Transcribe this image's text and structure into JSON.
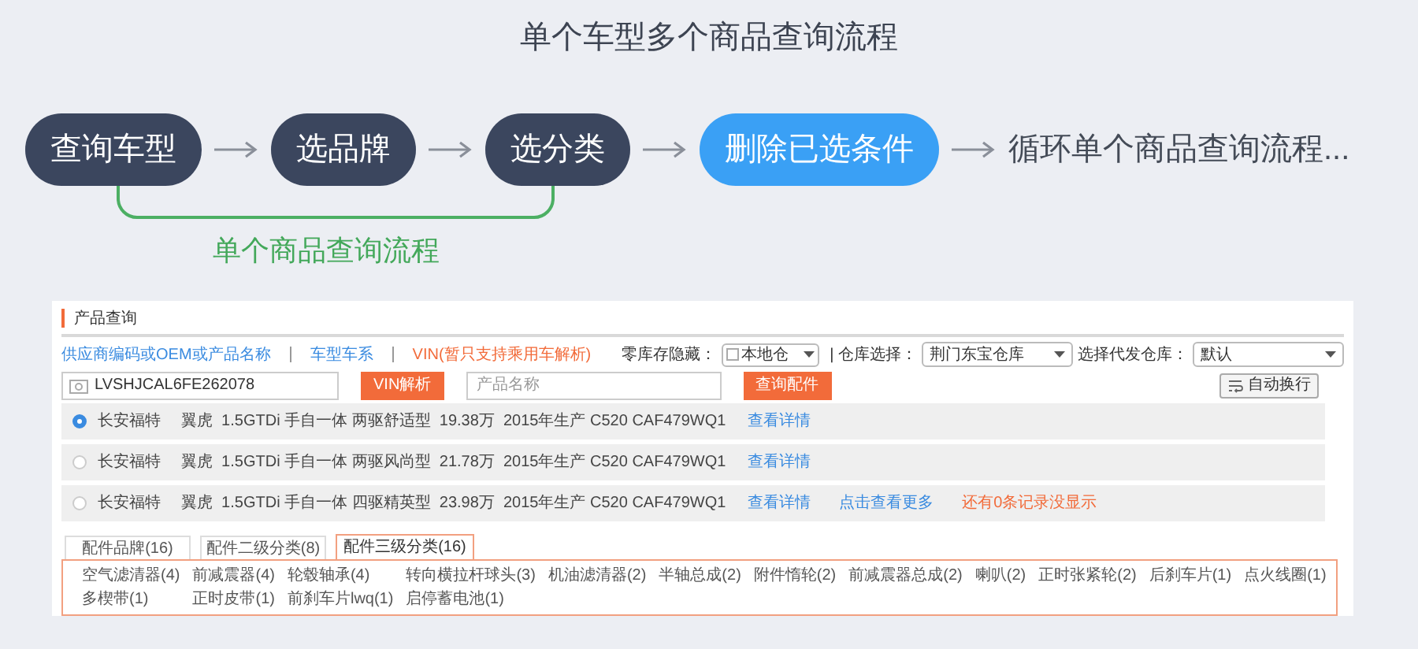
{
  "title": "单个车型多个商品查询流程",
  "flow": {
    "steps": [
      {
        "label": "查询车型",
        "kind": "step"
      },
      {
        "label": "选品牌",
        "kind": "step"
      },
      {
        "label": "选分类",
        "kind": "step"
      },
      {
        "label": "删除已选条件",
        "kind": "action"
      },
      {
        "label": "循环单个商品查询流程...",
        "kind": "text"
      }
    ],
    "bracket_label": "单个商品查询流程"
  },
  "panel": {
    "header": "产品查询",
    "modes": [
      {
        "label": "供应商编码或OEM或产品名称",
        "selected": false
      },
      {
        "label": "车型车系",
        "selected": false
      },
      {
        "label": "VIN(暂只支持乘用车解析)",
        "selected": true
      }
    ],
    "filters": {
      "zero_stock_label": "零库存隐藏：",
      "zero_stock_checked": false,
      "local_label": "本地仓",
      "warehouse_label": "| 仓库选择：",
      "warehouse_value": "荆门东宝仓库",
      "dropship_label": "选择代发仓库：",
      "dropship_value": "默认"
    },
    "vin_value": "LVSHJCAL6FE262078",
    "vin_button": "VIN解析",
    "name_placeholder": "产品名称",
    "search_button": "查询配件",
    "wrap_button": "自动换行",
    "results": [
      {
        "selected": true,
        "brand": "长安福特",
        "desc": "翼虎  1.5GTDi 手自一体 两驱舒适型  19.38万  2015年生产 C520 CAF479WQ1",
        "link": "查看详情"
      },
      {
        "selected": false,
        "brand": "长安福特",
        "desc": "翼虎  1.5GTDi 手自一体 两驱风尚型  21.78万  2015年生产 C520 CAF479WQ1",
        "link": "查看详情"
      },
      {
        "selected": false,
        "brand": "长安福特",
        "desc": "翼虎  1.5GTDi 手自一体 四驱精英型  23.98万  2015年生产 C520 CAF479WQ1",
        "link": "查看详情",
        "more": "点击查看更多",
        "notice": "还有0条记录没显示"
      }
    ],
    "tabs": [
      {
        "label": "配件品牌(16)",
        "selected": false
      },
      {
        "label": "配件二级分类(8)",
        "selected": false
      },
      {
        "label": "配件三级分类(16)",
        "selected": true
      }
    ],
    "categories": [
      "空气滤清器(4)",
      "前减震器(4)",
      "轮毂轴承(4)",
      "转向横拉杆球头(3)",
      "机油滤清器(2)",
      "半轴总成(2)",
      "附件惰轮(2)",
      "前减震器总成(2)",
      "喇叭(2)",
      "正时张紧轮(2)",
      "后刹车片(1)",
      "点火线圈(1)",
      "多楔带(1)",
      "正时皮带(1)",
      "前刹车片lwq(1)",
      "启停蓄电池(1)"
    ]
  }
}
